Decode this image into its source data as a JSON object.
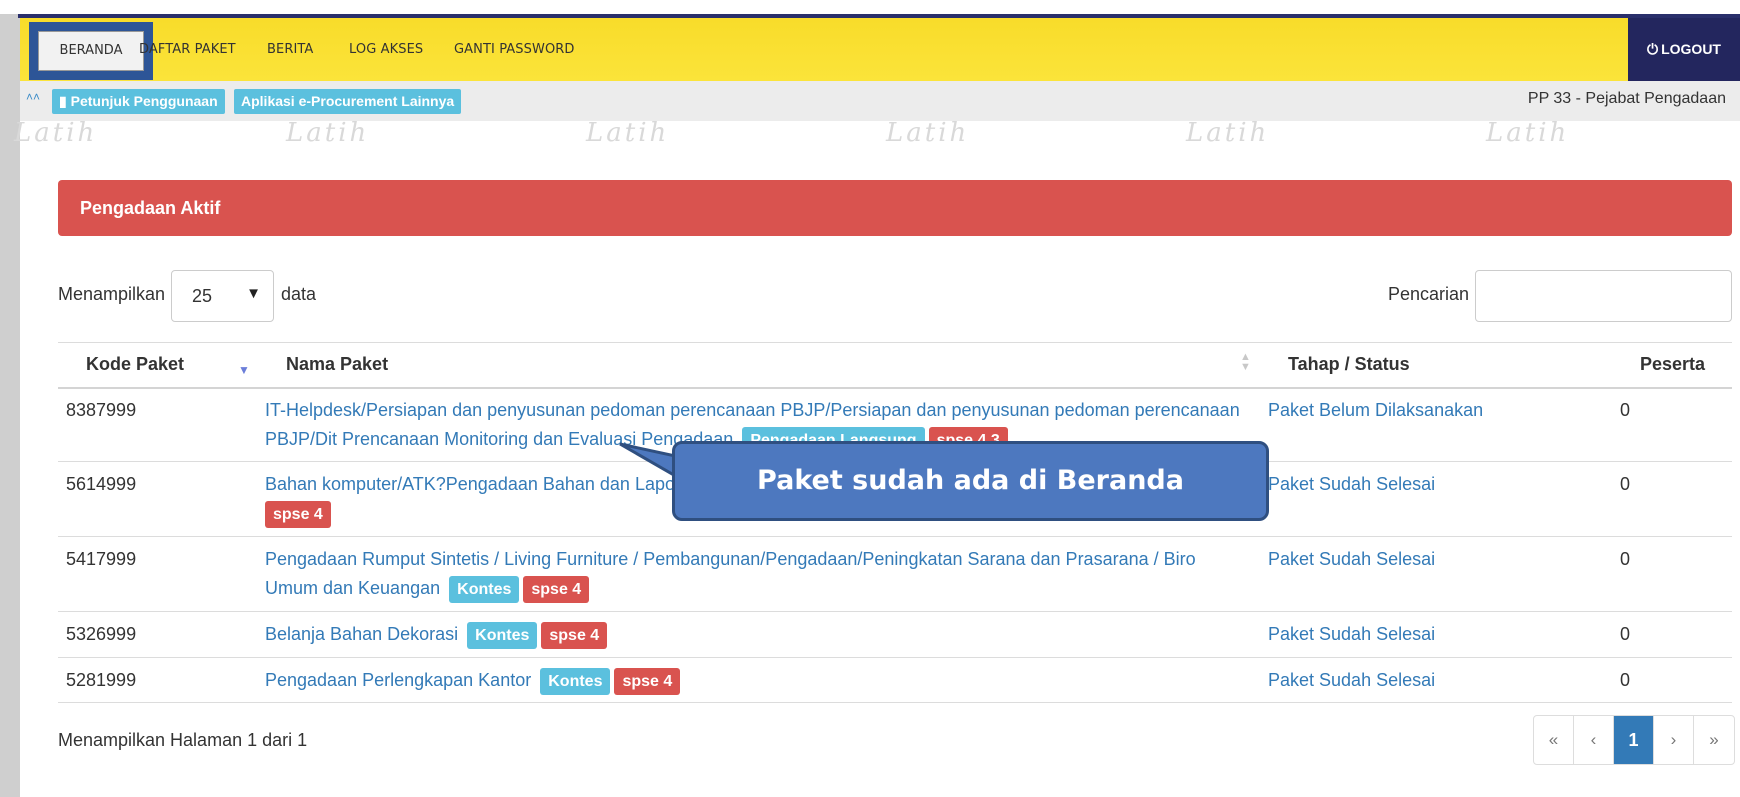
{
  "nav": {
    "items": [
      "BERANDA",
      "DAFTAR PAKET",
      "BERITA",
      "LOG AKSES",
      "GANTI PASSWORD"
    ],
    "logout_label": "LOGOUT"
  },
  "subbar": {
    "buttons": [
      "Petunjuk Penggunaan",
      "Aplikasi e-Procurement Lainnya"
    ],
    "user_role": "PP 33 - Pejabat Pengadaan"
  },
  "watermark": "Latih",
  "panel": {
    "title": "Pengadaan Aktif",
    "length_prefix": "Menampilkan",
    "length_value": "25",
    "length_suffix": "data",
    "search_label": "Pencarian",
    "search_value": ""
  },
  "table": {
    "columns": [
      "Kode Paket",
      "Nama Paket",
      "Tahap / Status",
      "Peserta"
    ],
    "rows": [
      {
        "kode": "8387999",
        "nama": "IT-Helpdesk/Persiapan dan penyusunan pedoman perencanaan PBJP/Persiapan dan penyusunan pedoman perencanaan PBJP/Dit Prencanaan Monitoring dan Evaluasi Pengadaan",
        "badges": [
          "Pengadaan Langsung",
          "spse 4.3"
        ],
        "status": "Paket Belum Dilaksanakan",
        "peserta": "0"
      },
      {
        "kode": "5614999",
        "nama": "Bahan komputer/ATK?Pengadaan Bahan dan Lapo",
        "badges": [
          "spse 4"
        ],
        "status": "Paket Sudah Selesai",
        "peserta": "0"
      },
      {
        "kode": "5417999",
        "nama": "Pengadaan Rumput Sintetis / Living Furniture / Pembangunan/Pengadaan/Peningkatan Sarana dan Prasarana / Biro Umum dan Keuangan",
        "badges": [
          "Kontes",
          "spse 4"
        ],
        "status": "Paket Sudah Selesai",
        "peserta": "0"
      },
      {
        "kode": "5326999",
        "nama": "Belanja Bahan Dekorasi",
        "badges": [
          "Kontes",
          "spse 4"
        ],
        "status": "Paket Sudah Selesai",
        "peserta": "0"
      },
      {
        "kode": "5281999",
        "nama": "Pengadaan Perlengkapan Kantor",
        "badges": [
          "Kontes",
          "spse 4"
        ],
        "status": "Paket Sudah Selesai",
        "peserta": "0"
      }
    ]
  },
  "footer": {
    "info": "Menampilkan Halaman 1 dari 1",
    "pagination": [
      "«",
      "‹",
      "1",
      "›",
      "»"
    ]
  },
  "callout": {
    "text": "Paket sudah ada di Beranda"
  },
  "colors": {
    "nav_bg": "#f8dc2a",
    "logout_bg": "#23265e",
    "panel_head": "#d9534f",
    "link": "#337ab7",
    "badge_info": "#5bc0de",
    "badge_danger": "#d9534f",
    "callout_bg": "#4d78bf"
  }
}
